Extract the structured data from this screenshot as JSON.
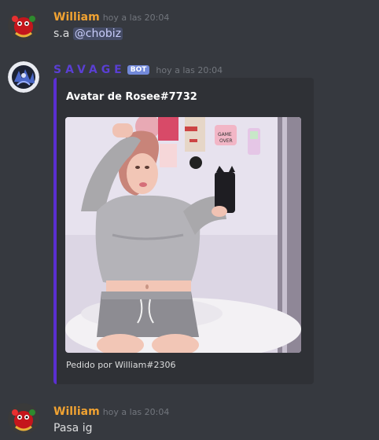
{
  "messages": [
    {
      "author": "William",
      "author_color": "#f0a232",
      "timestamp": "hoy a las 20:04",
      "text_prefix": "s.a ",
      "mention": "@chobiz"
    },
    {
      "author": "SAVAGE",
      "author_color": "#5a3fd3",
      "badge": "BOT",
      "timestamp": "hoy a las 20:04",
      "embed": {
        "accent_color": "#5a2fd0",
        "title": "Avatar de Rosee#7732",
        "footer": "Pedido por William#2306"
      }
    },
    {
      "author": "William",
      "author_color": "#f0a232",
      "timestamp": "hoy a las 20:04",
      "text": "Pasa ig"
    }
  ]
}
